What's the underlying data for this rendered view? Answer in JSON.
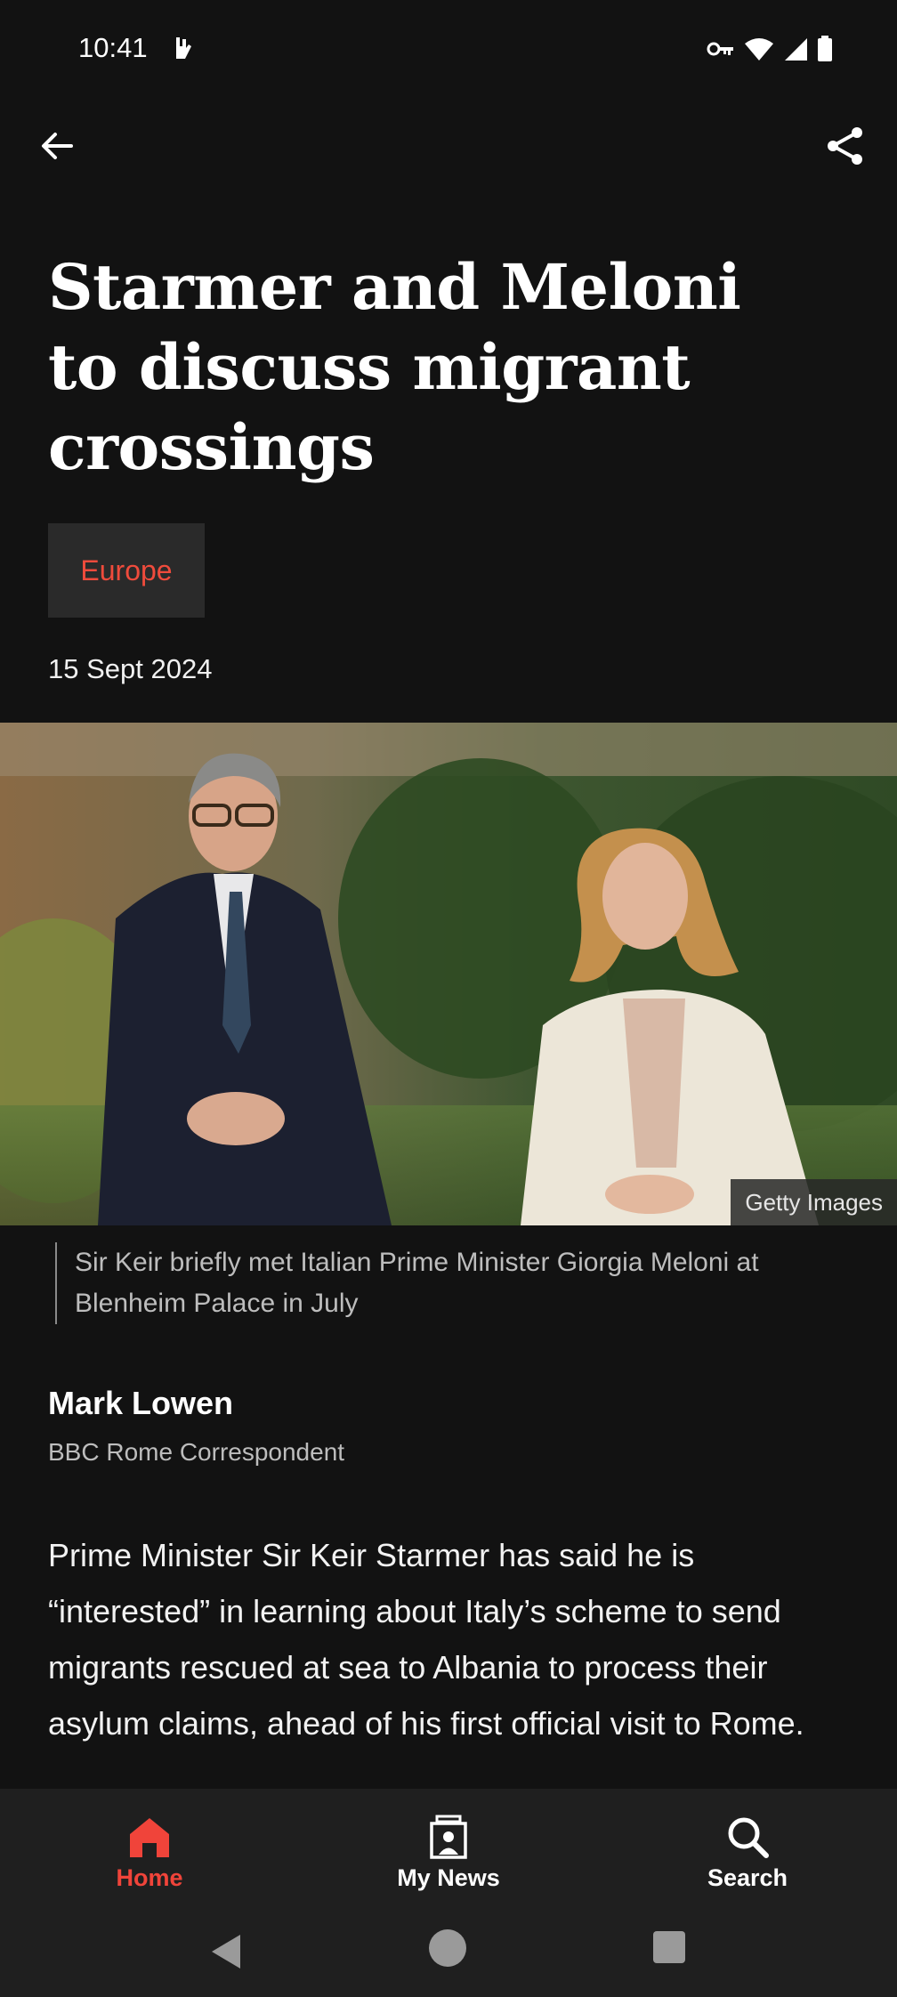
{
  "status_bar": {
    "time": "10:41",
    "icons": [
      "notification-icon",
      "vpn-key-icon",
      "wifi-icon",
      "signal-icon",
      "battery-icon"
    ]
  },
  "toolbar": {
    "back_icon": "back-arrow-icon",
    "share_icon": "share-icon"
  },
  "article": {
    "headline": "Starmer and Meloni to discuss migrant crossings",
    "topic": "Europe",
    "date": "15 Sept 2024",
    "image_credit": "Getty Images",
    "caption": "Sir Keir briefly met Italian Prime Minister Giorgia Meloni at Blenheim Palace in July",
    "author_name": "Mark Lowen",
    "author_role": "BBC Rome Correspondent",
    "body": "Prime Minister Sir Keir Starmer has said he is “interested” in learning about Italy’s scheme to send migrants rescued at sea to Albania to process their asylum claims, ahead of his first official visit to Rome."
  },
  "bottom_nav": {
    "items": [
      {
        "label": "Home",
        "icon": "home-icon",
        "active": true
      },
      {
        "label": "My News",
        "icon": "my-news-icon",
        "active": false
      },
      {
        "label": "Search",
        "icon": "search-icon",
        "active": false
      }
    ]
  },
  "colors": {
    "background": "#121212",
    "accent": "#f0443a",
    "topic_text": "#ef4b3c",
    "nav_background": "#1f1f1f"
  }
}
